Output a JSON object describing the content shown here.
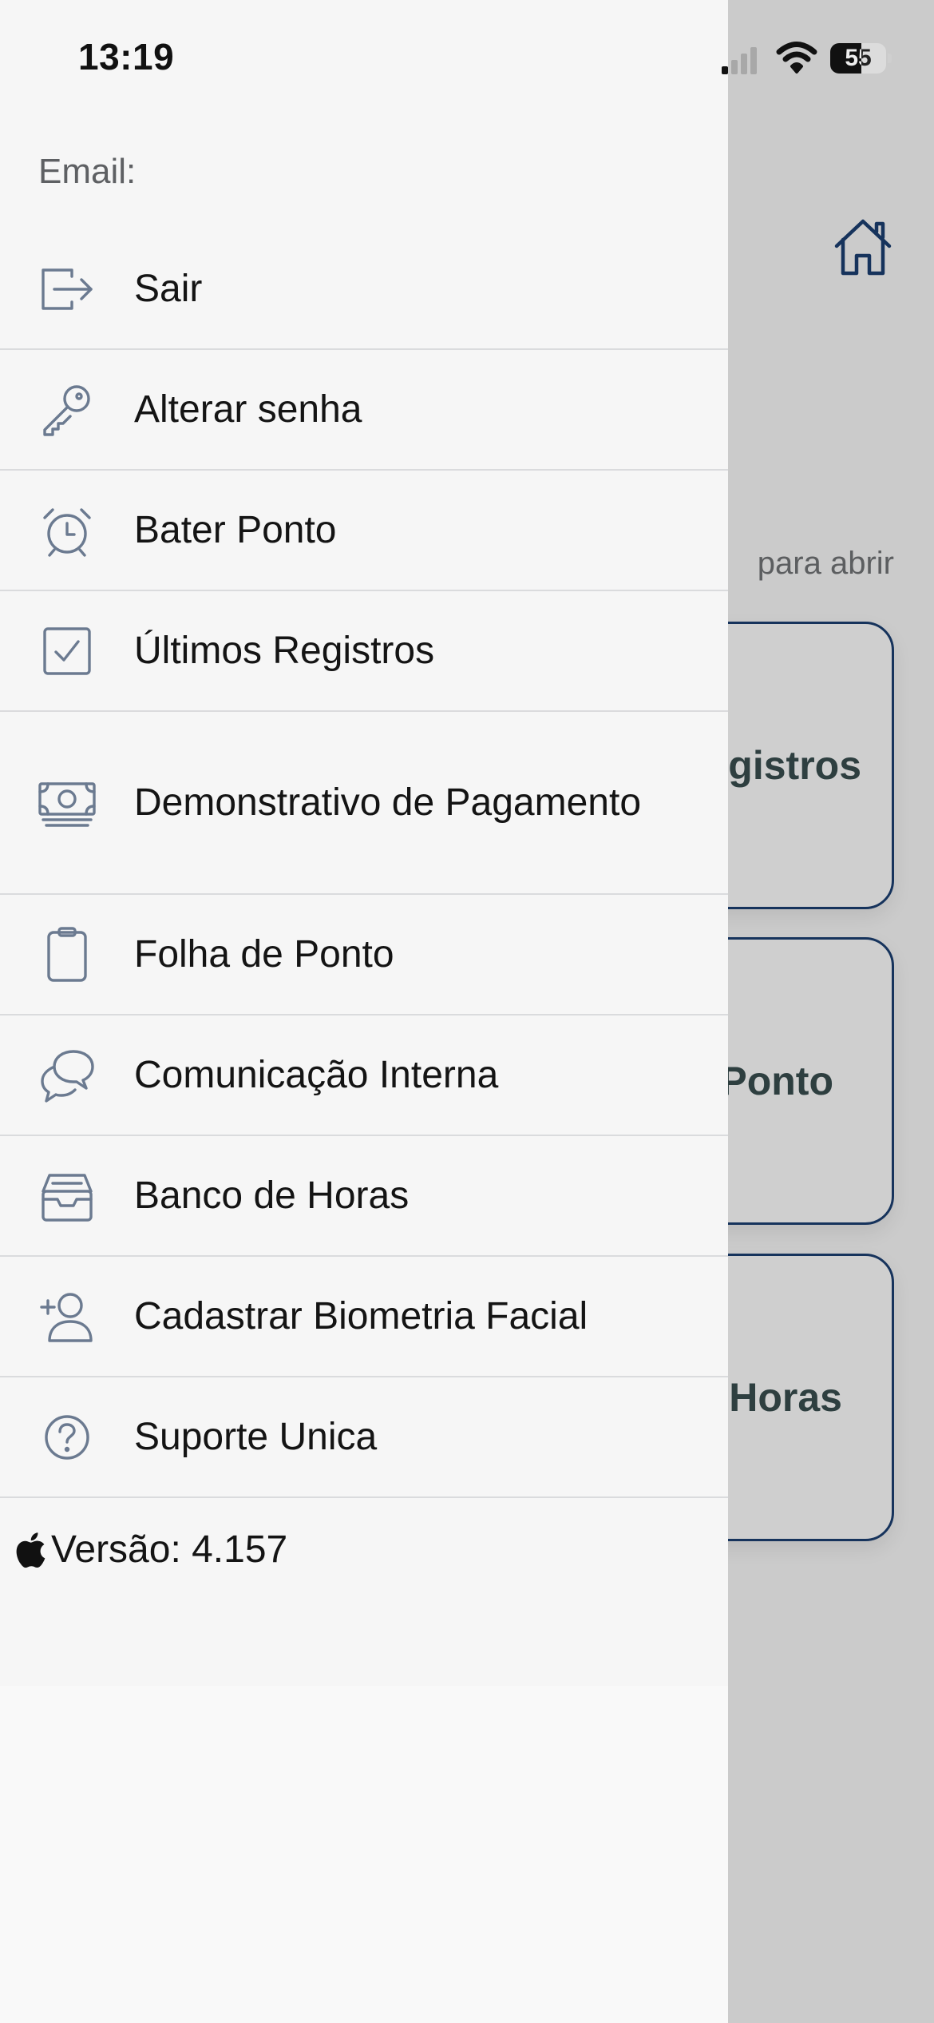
{
  "status_bar": {
    "time": "13:19",
    "battery_level": "55",
    "battery_fraction": 0.55
  },
  "background": {
    "hint_text": "para abrir",
    "cards": [
      {
        "label": "gistros"
      },
      {
        "label": "Ponto"
      },
      {
        "label": "Horas"
      }
    ],
    "accent_color": "#16335c"
  },
  "drawer": {
    "email_label": "Email:",
    "menu": [
      {
        "label": "Sair",
        "icon": "logout-icon"
      },
      {
        "label": "Alterar senha",
        "icon": "key-icon"
      },
      {
        "label": "Bater Ponto",
        "icon": "alarm-clock-icon"
      },
      {
        "label": "Últimos Registros",
        "icon": "checkbox-icon"
      },
      {
        "label": "Demonstrativo de Pagamento",
        "icon": "banknote-icon"
      },
      {
        "label": "Folha de Ponto",
        "icon": "clipboard-icon"
      },
      {
        "label": "Comunicação Interna",
        "icon": "chat-bubbles-icon"
      },
      {
        "label": "Banco de Horas",
        "icon": "inbox-tray-icon"
      },
      {
        "label": "Cadastrar Biometria Facial",
        "icon": "user-add-icon"
      },
      {
        "label": "Suporte Unica",
        "icon": "help-circle-icon"
      }
    ],
    "version_text": "Versão: 4.157",
    "icon_color": "#6b7a90"
  }
}
